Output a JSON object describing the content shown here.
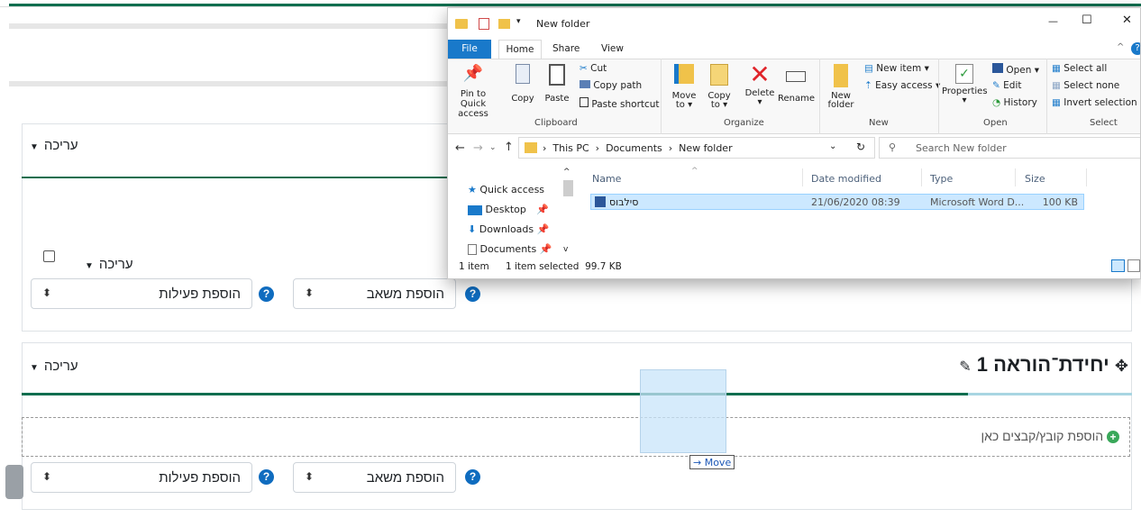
{
  "moodle": {
    "edit_label": "עריכה",
    "add_activity": "הוספת פעילות",
    "add_resource": "הוספת משאב",
    "section_title": "יחידת־הוראה 1",
    "dropzone_text": "הוספת קובץ/קבצים כאן",
    "help_glyph": "?",
    "select_arrow": "⬍",
    "caret": "▼",
    "plus": "+",
    "pencil": "✎",
    "move_cross": "✥",
    "drag_hint": "→ Move"
  },
  "explorer": {
    "title": "New folder",
    "tabs": [
      "File",
      "Home",
      "Share",
      "View"
    ],
    "controls": {
      "minimize": "—",
      "maximize": "☐",
      "close": "✕",
      "collapse": "^",
      "help": "?"
    },
    "ribbon": {
      "pin": "Pin to Quick access",
      "copy": "Copy",
      "paste": "Paste",
      "cut": "Cut",
      "copy_path": "Copy path",
      "paste_shortcut": "Paste shortcut",
      "move_to": "Move to ▾",
      "copy_to": "Copy to ▾",
      "delete": "Delete ▾",
      "rename": "Rename",
      "new_folder": "New folder",
      "new_item": "New item ▾",
      "easy_access": "Easy access ▾",
      "properties": "Properties ▾",
      "open": "Open ▾",
      "edit": "Edit",
      "history": "History",
      "select_all": "Select all",
      "select_none": "Select none",
      "invert_selection": "Invert selection",
      "groups": [
        "Clipboard",
        "Organize",
        "New",
        "Open",
        "Select"
      ]
    },
    "address": {
      "path": "›  This PC  ›  Documents  ›  New folder",
      "search_placeholder": "Search New folder"
    },
    "nav": [
      "Quick access",
      "Desktop",
      "Downloads",
      "Documents"
    ],
    "columns": [
      "Name",
      "Date modified",
      "Type",
      "Size"
    ],
    "file": {
      "name": "סילבוס",
      "date": "21/06/2020 08:39",
      "type": "Microsoft Word D...",
      "size": "100 KB"
    },
    "status": {
      "count": "1 item",
      "selected": "1 item selected  99.7 KB"
    }
  },
  "colors": {
    "green": "#0f6e4f",
    "moodle_blue": "#0f6cbf",
    "explorer_blue": "#1979ca",
    "selection": "#cce8ff"
  }
}
